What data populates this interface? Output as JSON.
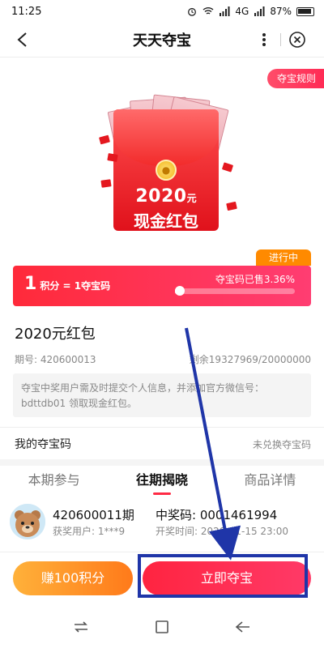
{
  "status_bar": {
    "time": "11:25",
    "network": "4G",
    "battery": "87%"
  },
  "nav": {
    "title": "天天夺宝"
  },
  "rules_badge": "夺宝规则",
  "hero": {
    "amount": "2020",
    "unit": "元",
    "subtitle": "现金红包"
  },
  "progress": {
    "status": "进行中",
    "rate_number": "1",
    "rate_text": "积分 = 1夺宝码",
    "sold_text": "夺宝码已售3.36%",
    "sold_fraction": 0.0336
  },
  "product": {
    "title": "2020元红包",
    "issue": "期号: 420600013",
    "remaining": "剩余19327969/20000000",
    "notice": "夺宝中奖用户需及时提交个人信息，并添加官方微信号：bdttdb01 领取现金红包。"
  },
  "my_codes": {
    "label": "我的夺宝码",
    "status": "未兑换夺宝码"
  },
  "tabs": [
    {
      "label": "本期参与"
    },
    {
      "label": "往期揭晓"
    },
    {
      "label": "商品详情"
    }
  ],
  "winner": {
    "issue": "420600011期",
    "user": "获奖用户: 1***9",
    "code": "中奖码: 0001461994",
    "time": "开奖时间: 2020-01-15 23:00"
  },
  "actions": {
    "earn": "赚100积分",
    "join": "立即夺宝"
  },
  "colors": {
    "primary_red": "#ff2440",
    "orange": "#ff8a00",
    "annotation_blue": "#1f35a8"
  },
  "icons": [
    "back-icon",
    "more-icon",
    "close-icon",
    "recent-apps-icon",
    "home-icon",
    "back-nav-icon"
  ]
}
